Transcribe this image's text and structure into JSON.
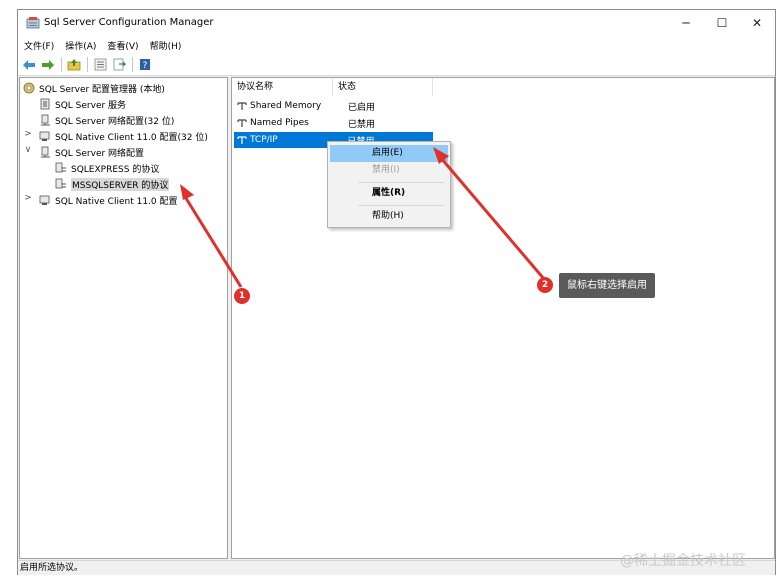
{
  "window": {
    "title": "Sql Server Configuration Manager",
    "controls": {
      "minimize": "─",
      "maximize": "☐",
      "close": "✕"
    }
  },
  "menubar": {
    "items": [
      "文件(F)",
      "操作(A)",
      "查看(V)",
      "帮助(H)"
    ]
  },
  "toolbar": {
    "icons": [
      "back-arrow-icon",
      "forward-arrow-icon",
      "up-folder-icon",
      "properties-icon",
      "export-icon",
      "help-book-icon"
    ]
  },
  "tree": {
    "root": "SQL Server 配置管理器 (本地)",
    "items": [
      {
        "label": "SQL Server 服务",
        "level": 1,
        "twisty": ""
      },
      {
        "label": "SQL Server 网络配置(32 位)",
        "level": 1,
        "twisty": ""
      },
      {
        "label": "SQL Native Client 11.0 配置(32 位)",
        "level": 1,
        "twisty": ">"
      },
      {
        "label": "SQL Server 网络配置",
        "level": 1,
        "twisty": "∨"
      },
      {
        "label": "SQLEXPRESS 的协议",
        "level": 2,
        "twisty": ""
      },
      {
        "label": "MSSQLSERVER 的协议",
        "level": 2,
        "twisty": ""
      },
      {
        "label": "SQL Native Client 11.0 配置",
        "level": 1,
        "twisty": ">"
      }
    ]
  },
  "list": {
    "columns": [
      "协议名称",
      "状态"
    ],
    "rows": [
      {
        "name": "Shared Memory",
        "state": "已启用"
      },
      {
        "name": "Named Pipes",
        "state": "已禁用"
      },
      {
        "name": "TCP/IP",
        "state": "已禁用"
      }
    ]
  },
  "context_menu": {
    "items": [
      "启用(E)",
      "禁用(I)",
      "属性(R)",
      "帮助(H)"
    ]
  },
  "status": "启用所选协议。",
  "annotations": {
    "badge1": "1",
    "badge2": "2",
    "callout": "鼠标右键选择启用",
    "arrow_color": "#e0302c"
  },
  "watermark": "@稀土掘金技术社区",
  "colors": {
    "selection": "#0078d7",
    "menu_hover": "#91c9f7"
  }
}
